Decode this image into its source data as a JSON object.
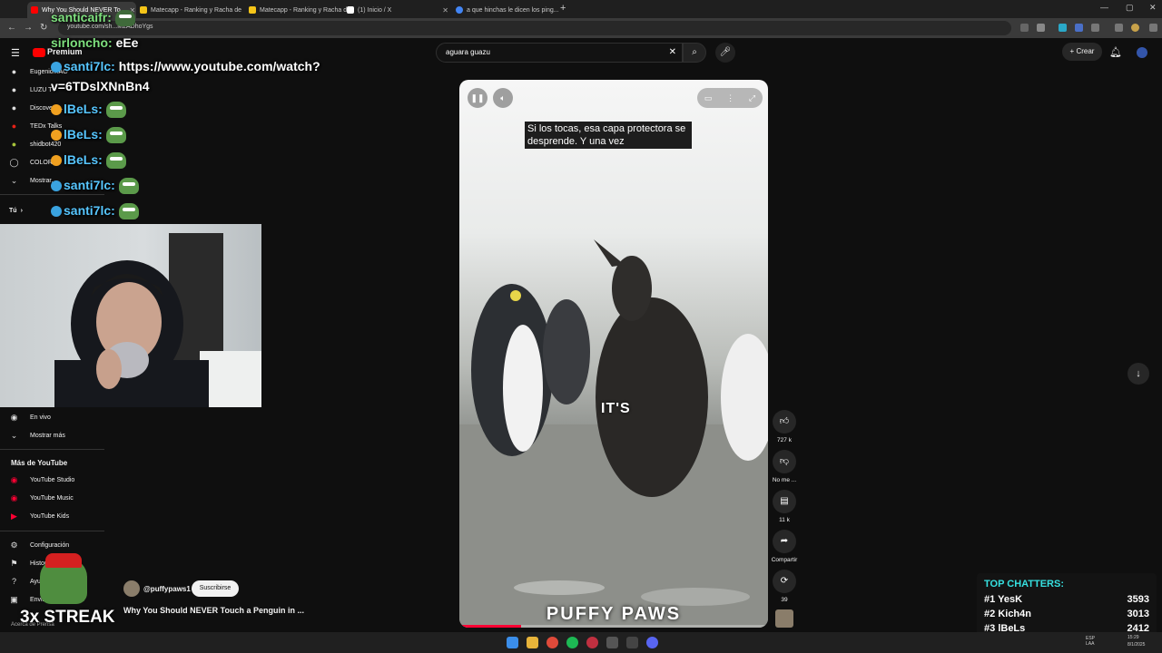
{
  "tabs": [
    {
      "label": "Why You Should NEVER To...",
      "active": true,
      "color": "#ff0000"
    },
    {
      "label": "Matecapp - Ranking y Racha de",
      "active": false,
      "color": "#f5c518"
    },
    {
      "label": "Matecapp - Ranking y Racha de",
      "active": false,
      "color": "#f5c518"
    },
    {
      "label": "(1) Inicio / X",
      "active": false,
      "color": "#ffffff"
    },
    {
      "label": "a que hinchas le dicen los ping...",
      "active": false,
      "color": "#4285f4"
    }
  ],
  "address": "youtube.com/sh...M2ADhoYgs",
  "header": {
    "logo": "Premium",
    "search_value": "aguara guazu",
    "create_label": "+ Crear"
  },
  "sidebar": {
    "subscriptions": [
      {
        "label": "Eugenio...AO",
        "icon": "channel-avatar-icon"
      },
      {
        "label": "LUZU TV",
        "icon": "channel-avatar-icon"
      },
      {
        "label": "Discovery...",
        "icon": "channel-avatar-icon"
      },
      {
        "label": "TEDx Talks",
        "icon": "channel-avatar-icon"
      },
      {
        "label": "shidbot420",
        "icon": "channel-avatar-icon"
      },
      {
        "label": "COLORS",
        "icon": "channel-avatar-icon"
      },
      {
        "label": "Mostrar...",
        "icon": "chevron-down-icon"
      }
    ],
    "you_label": "Tú",
    "live_label": "En vivo",
    "show_more_label": "Mostrar más",
    "more_heading": "Más de YouTube",
    "more_items": [
      "YouTube Studio",
      "YouTube Music",
      "YouTube Kids"
    ],
    "settings_items": [
      "Configuración",
      "Historial...",
      "Ayuda",
      "Enviar comentarios"
    ],
    "footer": "Acerca de   Prensa"
  },
  "chat": [
    {
      "name": "santicaifr:",
      "text": ""
    },
    {
      "name": "sirloncho:",
      "text": "eEe"
    },
    {
      "name": "santi7lc:",
      "text": "https://www.youtube.com/watch?"
    },
    {
      "name": "",
      "text": "v=6TDslXNnBn4"
    },
    {
      "name": "lBeLs:",
      "text": ""
    },
    {
      "name": "lBeLs:",
      "text": ""
    },
    {
      "name": "lBeLs:",
      "text": ""
    },
    {
      "name": "santi7lc:",
      "text": ""
    },
    {
      "name": "santi7lc:",
      "text": ""
    }
  ],
  "player": {
    "caption": "Si los tocas, esa capa protectora se desprende.  Y una vez",
    "overlay_word": "IT'S",
    "brand_text": "PUFFY PAWS",
    "progress": 0.2
  },
  "actions": [
    {
      "icon": "thumbs-up-icon",
      "label": "727 k"
    },
    {
      "icon": "thumbs-down-icon",
      "label": "No me ..."
    },
    {
      "icon": "comment-icon",
      "label": "11 k"
    },
    {
      "icon": "share-icon",
      "label": "Compartir"
    },
    {
      "icon": "remix-icon",
      "label": "39"
    }
  ],
  "channel": {
    "handle": "@puffypaws1",
    "subscribe_label": "Suscribirse",
    "title": "Why You Should NEVER Touch a Penguin in ..."
  },
  "streak": "3x STREAK",
  "top_chatters": {
    "title": "TOP CHATTERS:",
    "rows": [
      {
        "rank": "#1",
        "name": "YesK",
        "count": "3593"
      },
      {
        "rank": "#2",
        "name": "Kich4n",
        "count": "3013"
      },
      {
        "rank": "#3",
        "name": "lBeLs",
        "count": "2412"
      }
    ]
  },
  "taskbar": {
    "lang": "ESP LAA",
    "time": "15:29",
    "date": "8/1/2025"
  }
}
